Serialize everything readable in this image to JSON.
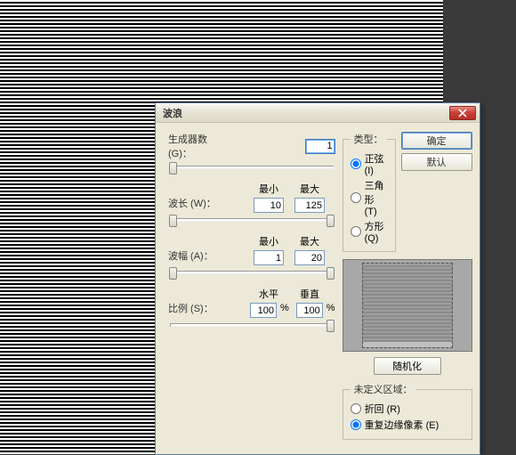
{
  "dialog": {
    "title": "波浪",
    "close_icon": "close"
  },
  "generators": {
    "label": "生成器数 (G)：",
    "value": "1"
  },
  "wavelength": {
    "label": "波长 (W)：",
    "min_label": "最小",
    "max_label": "最大",
    "min": "10",
    "max": "125"
  },
  "amplitude": {
    "label": "波幅 (A)：",
    "min_label": "最小",
    "max_label": "最大",
    "min": "1",
    "max": "20"
  },
  "scale": {
    "label": "比例 (S)：",
    "h_label": "水平",
    "v_label": "垂直",
    "h": "100",
    "v": "100",
    "pct": "%"
  },
  "type": {
    "legend": "类型：",
    "sine": "正弦 (I)",
    "triangle": "三角形 (T)",
    "square": "方形 (Q)"
  },
  "buttons": {
    "ok": "确定",
    "default": "默认",
    "randomize": "随机化"
  },
  "undefined_area": {
    "legend": "未定义区域：",
    "wrap": "折回 (R)",
    "repeat": "重复边缘像素 (E)"
  }
}
